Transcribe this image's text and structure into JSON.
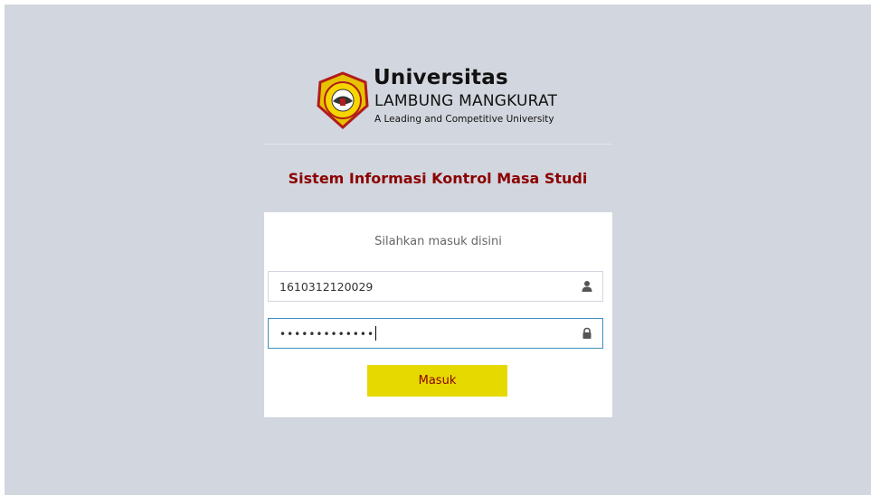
{
  "brand": {
    "name": "Universitas",
    "subname": "LAMBUNG MANGKURAT",
    "tagline": "A Leading and Competitive University",
    "seal_text": "UNIVERSITAS LAMBUNG MANGKURAT"
  },
  "app": {
    "title": "Sistem Informasi Kontrol Masa Studi"
  },
  "login": {
    "message": "Silahkan masuk disini",
    "username_value": "1610312120029",
    "username_icon": "user-icon",
    "password_mask": "•••••••••••••",
    "password_icon": "lock-icon",
    "submit_label": "Masuk"
  },
  "colors": {
    "background": "#d2d6de",
    "title": "#8b0000",
    "button": "#e6d900",
    "focus_border": "#3c8dbc"
  }
}
